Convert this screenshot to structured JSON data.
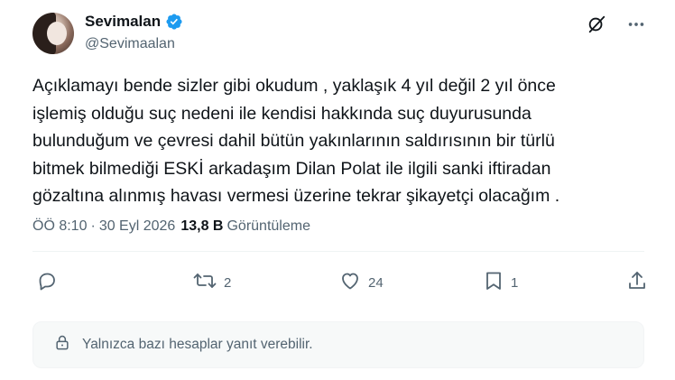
{
  "author": {
    "display_name": "Sevimalan",
    "handle": "@Sevimaalan",
    "verified": true
  },
  "tweet": {
    "lines": [
      "Açıklamayı bende sizler gibi okudum , yaklaşık 4 yıl değil 2 yıl önce",
      "işlemiş olduğu suç nedeni ile kendisi hakkında suç duyurusunda",
      "bulunduğum ve çevresi dahil bütün yakınlarının saldırısının bir türlü",
      "bitmek bilmediği ESKİ arkadaşım Dilan Polat ile ilgili sanki iftiradan",
      "gözaltına alınmış havası vermesi üzerine tekrar şikayetçi olacağım ."
    ]
  },
  "meta": {
    "time": "ÖÖ 8:10",
    "separator": "·",
    "date": "30 Eyl 2026",
    "views_count": "13,8 B",
    "views_label": "Görüntüleme"
  },
  "actions": {
    "reply_count": "",
    "retweet_count": "2",
    "like_count": "24",
    "bookmark_count": "1"
  },
  "reply_restriction": {
    "text": "Yalnızca bazı hesaplar yanıt verebilir."
  },
  "colors": {
    "primary_text": "#0f1419",
    "secondary_text": "#536471",
    "verified_blue": "#1d9bf0"
  },
  "icons": {
    "verified": "verified-badge-icon",
    "grok": "grok-icon",
    "more": "more-icon",
    "reply": "reply-icon",
    "retweet": "retweet-icon",
    "like": "heart-icon",
    "bookmark": "bookmark-icon",
    "share": "share-icon",
    "lock": "lock-icon"
  }
}
